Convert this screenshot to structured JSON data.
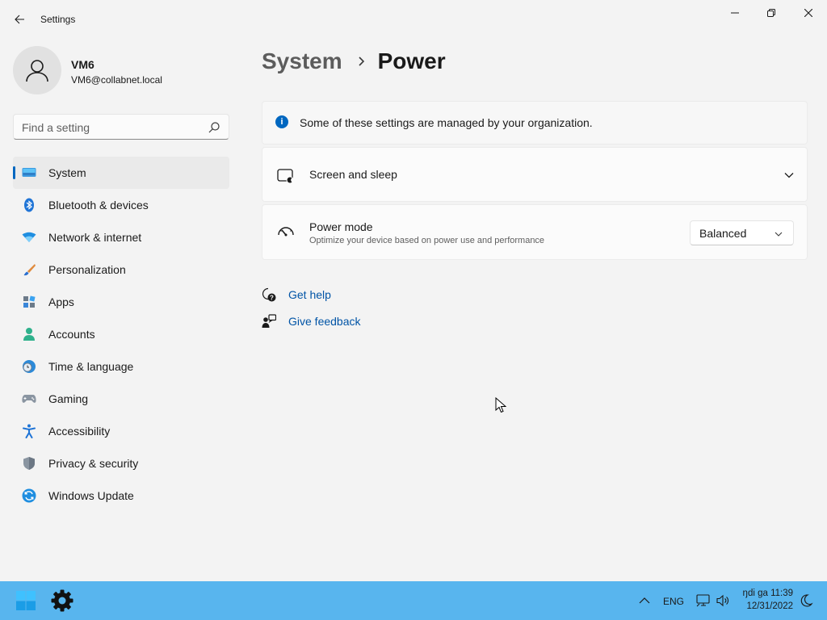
{
  "window": {
    "title": "Settings",
    "back_label": "Back",
    "controls": [
      "minimize",
      "maximize",
      "close"
    ]
  },
  "profile": {
    "name": "VM6",
    "email": "VM6@collabnet.local"
  },
  "search": {
    "placeholder": "Find a setting",
    "value": ""
  },
  "sidebar": {
    "items": [
      {
        "label": "System",
        "icon": "system-icon",
        "active": true
      },
      {
        "label": "Bluetooth & devices",
        "icon": "bluetooth-icon",
        "active": false
      },
      {
        "label": "Network & internet",
        "icon": "wifi-icon",
        "active": false
      },
      {
        "label": "Personalization",
        "icon": "brush-icon",
        "active": false
      },
      {
        "label": "Apps",
        "icon": "apps-icon",
        "active": false
      },
      {
        "label": "Accounts",
        "icon": "accounts-icon",
        "active": false
      },
      {
        "label": "Time & language",
        "icon": "clock-globe-icon",
        "active": false
      },
      {
        "label": "Gaming",
        "icon": "gamepad-icon",
        "active": false
      },
      {
        "label": "Accessibility",
        "icon": "accessibility-icon",
        "active": false
      },
      {
        "label": "Privacy & security",
        "icon": "shield-icon",
        "active": false
      },
      {
        "label": "Windows Update",
        "icon": "update-icon",
        "active": false
      }
    ]
  },
  "breadcrumb": {
    "parent": "System",
    "current": "Power"
  },
  "main": {
    "info_bar": "Some of these settings are managed by your organization.",
    "screen_sleep": {
      "title": "Screen and sleep"
    },
    "power_mode": {
      "title": "Power mode",
      "description": "Optimize your device based on power use and performance",
      "value": "Balanced"
    },
    "links": {
      "help": "Get help",
      "feedback": "Give feedback"
    }
  },
  "taskbar": {
    "language": "ENG",
    "time": "ŋdi ga 11:39",
    "date": "12/31/2022"
  },
  "colors": {
    "accent": "#0067c0",
    "taskbar": "#58b5ee",
    "link": "#0054a6"
  }
}
